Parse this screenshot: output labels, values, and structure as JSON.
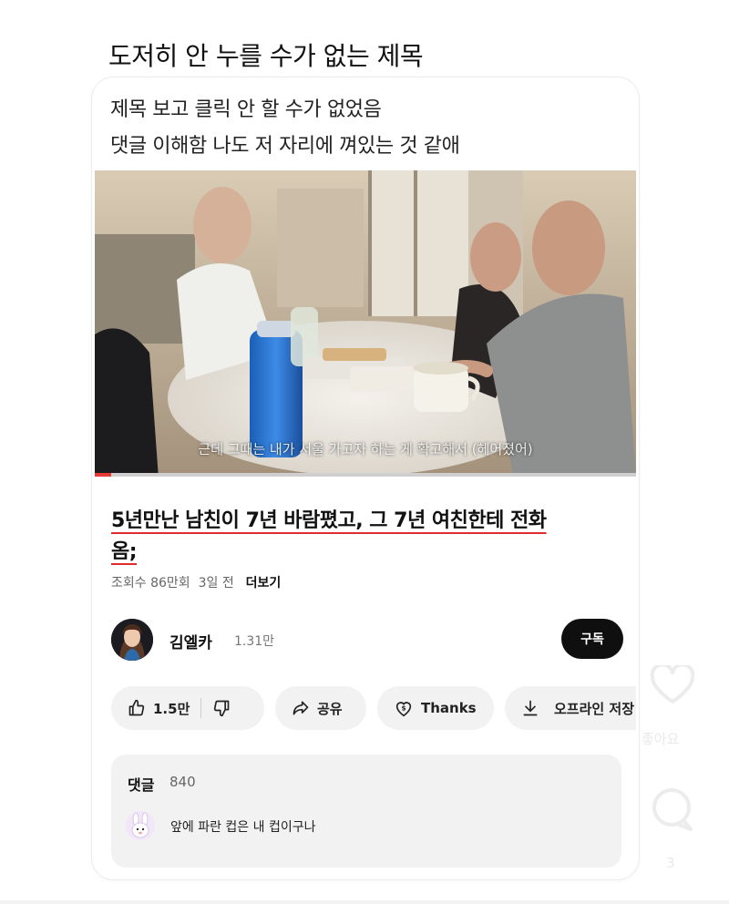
{
  "post": {
    "title": "도저히 안 누를 수가 없는 제목",
    "caption_line1": "제목 보고 클릭 안 할 수가 없었음",
    "caption_line2": "댓글 이해함 나도 저 자리에 껴있는 것 같애"
  },
  "video": {
    "subtitle": "근데 그때는 내가 서울 가고자 하는 게 확고해서 (헤어졌어)",
    "progress": 0.03,
    "title_part1": "5년만난 남친이 7년 바람폈고, 그 7년 여친한테 전화",
    "title_part2": "옴;",
    "views": "조회수 86만회",
    "age": "3일 전",
    "more": "더보기",
    "channel_name": "김엘카",
    "subscribers": "1.31만",
    "subscribe_label": "구독",
    "like_count": "1.5만",
    "share_label": "공유",
    "thanks_label": "Thanks",
    "download_label": "오프라인 저장",
    "comments_label": "댓글",
    "comments_count": "840",
    "top_comment": "앞에 파란 컵은 내 컵이구나"
  },
  "side": {
    "like_label": "좋아요",
    "comment_count": "3"
  },
  "colors": {
    "accent_red": "#e02b2b",
    "subscribe_bg": "#0f0f0f",
    "pill_bg": "#f2f2f2"
  },
  "icons": [
    "thumbs-up-icon",
    "thumbs-down-icon",
    "share-icon",
    "thanks-icon",
    "download-icon",
    "heart-icon",
    "comment-bubble-icon"
  ]
}
